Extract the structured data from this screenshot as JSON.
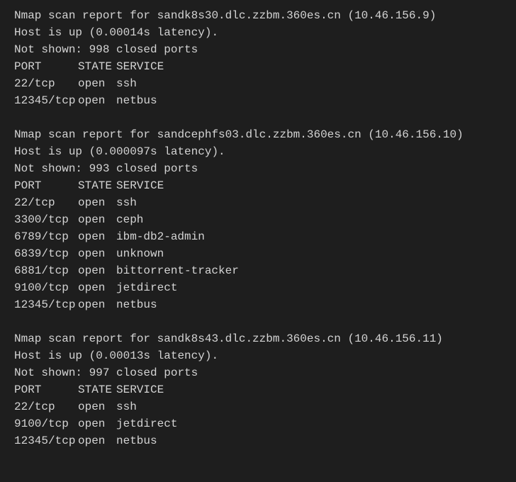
{
  "reports": [
    {
      "header": "Nmap scan report for sandk8s30.dlc.zzbm.360es.cn (10.46.156.9)",
      "host_status": "Host is up (0.00014s latency).",
      "not_shown": "Not shown: 998 closed ports",
      "col_port": "PORT",
      "col_state": "STATE",
      "col_service": "SERVICE",
      "ports": [
        {
          "port": "22/tcp",
          "state": "open",
          "service": "ssh"
        },
        {
          "port": "12345/tcp",
          "state": "open",
          "service": "netbus"
        }
      ]
    },
    {
      "header": "Nmap scan report for sandcephfs03.dlc.zzbm.360es.cn (10.46.156.10)",
      "host_status": "Host is up (0.000097s latency).",
      "not_shown": "Not shown: 993 closed ports",
      "col_port": "PORT",
      "col_state": "STATE",
      "col_service": "SERVICE",
      "ports": [
        {
          "port": "22/tcp",
          "state": "open",
          "service": "ssh"
        },
        {
          "port": "3300/tcp",
          "state": "open",
          "service": "ceph"
        },
        {
          "port": "6789/tcp",
          "state": "open",
          "service": "ibm-db2-admin"
        },
        {
          "port": "6839/tcp",
          "state": "open",
          "service": "unknown"
        },
        {
          "port": "6881/tcp",
          "state": "open",
          "service": "bittorrent-tracker"
        },
        {
          "port": "9100/tcp",
          "state": "open",
          "service": "jetdirect"
        },
        {
          "port": "12345/tcp",
          "state": "open",
          "service": "netbus"
        }
      ]
    },
    {
      "header": "Nmap scan report for sandk8s43.dlc.zzbm.360es.cn (10.46.156.11)",
      "host_status": "Host is up (0.00013s latency).",
      "not_shown": "Not shown: 997 closed ports",
      "col_port": "PORT",
      "col_state": "STATE",
      "col_service": "SERVICE",
      "ports": [
        {
          "port": "22/tcp",
          "state": "open",
          "service": "ssh"
        },
        {
          "port": "9100/tcp",
          "state": "open",
          "service": "jetdirect"
        },
        {
          "port": "12345/tcp",
          "state": "open",
          "service": "netbus"
        }
      ]
    }
  ]
}
